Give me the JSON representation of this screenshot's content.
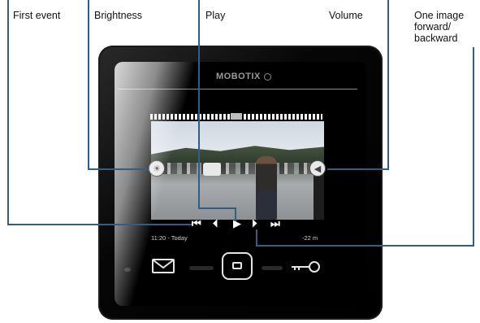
{
  "callouts": {
    "first_event": "First event",
    "brightness": "Brightness",
    "play": "Play",
    "volume": "Volume",
    "one_image": "One image forward/ backward"
  },
  "device": {
    "brand": "MOBOTIX",
    "status_left": "11:20 - Today",
    "status_right": "-22 m",
    "controls": {
      "first": "⏮",
      "prev": "⏴",
      "play": "▶",
      "next": "⏵",
      "last": "⏭"
    }
  },
  "icons": {
    "brightness": "sun-icon",
    "volume": "speaker-icon",
    "mail": "envelope-icon",
    "bell": "doorbell-icon",
    "key": "key-icon"
  },
  "colors": {
    "callout_line": "#2f5f86",
    "housing": "#000000"
  }
}
